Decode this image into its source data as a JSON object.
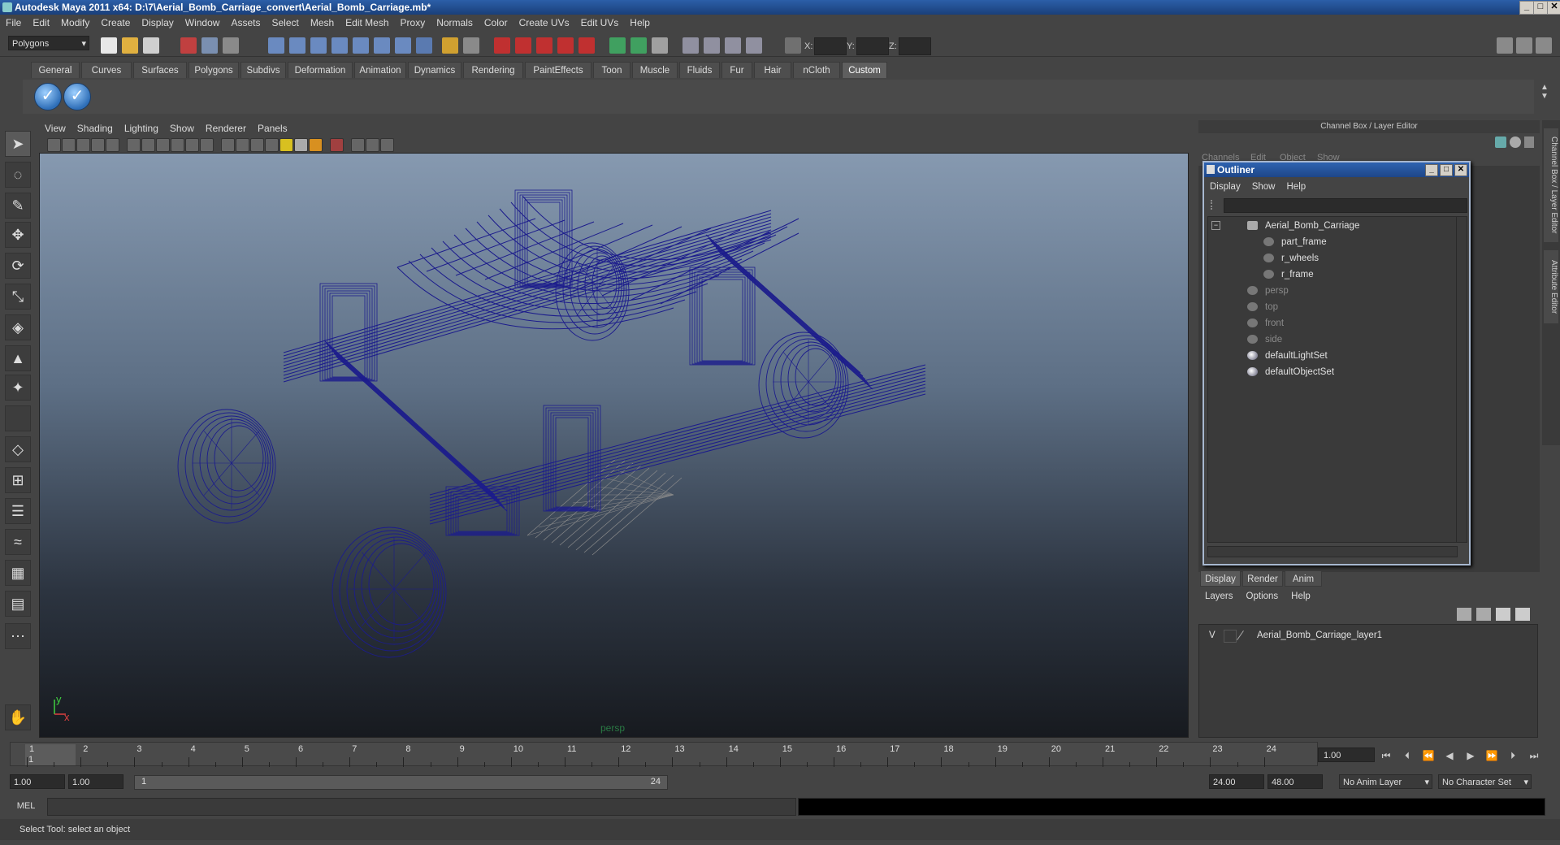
{
  "window": {
    "title": "Autodesk Maya 2011 x64: D:\\7\\Aerial_Bomb_Carriage_convert\\Aerial_Bomb_Carriage.mb*",
    "min": "_",
    "max": "□",
    "close": "✕"
  },
  "menubar": [
    "File",
    "Edit",
    "Modify",
    "Create",
    "Display",
    "Window",
    "Assets",
    "Select",
    "Mesh",
    "Edit Mesh",
    "Proxy",
    "Normals",
    "Color",
    "Create UVs",
    "Edit UVs",
    "Help"
  ],
  "status_line": {
    "mode": "Polygons",
    "x_label": "X:",
    "y_label": "Y:",
    "z_label": "Z:"
  },
  "shelf": {
    "tabs": [
      "General",
      "Curves",
      "Surfaces",
      "Polygons",
      "Subdivs",
      "Deformation",
      "Animation",
      "Dynamics",
      "Rendering",
      "PaintEffects",
      "Toon",
      "Muscle",
      "Fluids",
      "Fur",
      "Hair",
      "nCloth",
      "Custom"
    ],
    "active_tab": "Custom"
  },
  "viewport": {
    "menu": [
      "View",
      "Shading",
      "Lighting",
      "Show",
      "Renderer",
      "Panels"
    ],
    "camera": "persp",
    "axis_x": "x",
    "axis_y": "y",
    "wire_color": "#1c1c8c"
  },
  "channel_box": {
    "title": "Channel Box / Layer Editor",
    "menu": [
      "Channels",
      "Edit",
      "Object",
      "Show"
    ]
  },
  "outliner": {
    "title": "Outliner",
    "menu": [
      "Display",
      "Show",
      "Help"
    ],
    "items": [
      {
        "label": "Aerial_Bomb_Carriage",
        "indent": 0,
        "dim": false,
        "kind": "grp"
      },
      {
        "label": "part_frame",
        "indent": 1,
        "dim": false,
        "kind": "mesh"
      },
      {
        "label": "r_wheels",
        "indent": 1,
        "dim": false,
        "kind": "mesh"
      },
      {
        "label": "r_frame",
        "indent": 1,
        "dim": false,
        "kind": "mesh"
      },
      {
        "label": "persp",
        "indent": 0,
        "dim": true,
        "kind": "cam"
      },
      {
        "label": "top",
        "indent": 0,
        "dim": true,
        "kind": "cam"
      },
      {
        "label": "front",
        "indent": 0,
        "dim": true,
        "kind": "cam"
      },
      {
        "label": "side",
        "indent": 0,
        "dim": true,
        "kind": "cam"
      },
      {
        "label": "defaultLightSet",
        "indent": 0,
        "dim": false,
        "kind": "set"
      },
      {
        "label": "defaultObjectSet",
        "indent": 0,
        "dim": false,
        "kind": "set"
      }
    ]
  },
  "layer_editor": {
    "tabs": [
      "Display",
      "Render",
      "Anim"
    ],
    "menu": [
      "Layers",
      "Options",
      "Help"
    ],
    "visibility": "V",
    "layer_name": "Aerial_Bomb_Carriage_layer1"
  },
  "side_tabs": [
    "Channel Box / Layer Editor",
    "Attribute Editor"
  ],
  "timeline": {
    "ticks": [
      "1",
      "2",
      "3",
      "4",
      "5",
      "6",
      "7",
      "8",
      "9",
      "10",
      "11",
      "12",
      "13",
      "14",
      "15",
      "16",
      "17",
      "18",
      "19",
      "20",
      "21",
      "22",
      "23",
      "24"
    ],
    "current_frame": "1.00",
    "current_marker": "1"
  },
  "range": {
    "start": "1.00",
    "playback_start": "1.00",
    "slider_start": "1",
    "slider_end": "24",
    "playback_end": "24.00",
    "end": "48.00",
    "anim_layer": "No Anim Layer",
    "character_set": "No Character Set"
  },
  "command_line": {
    "label": "MEL"
  },
  "help_line": "Select Tool: select an object"
}
